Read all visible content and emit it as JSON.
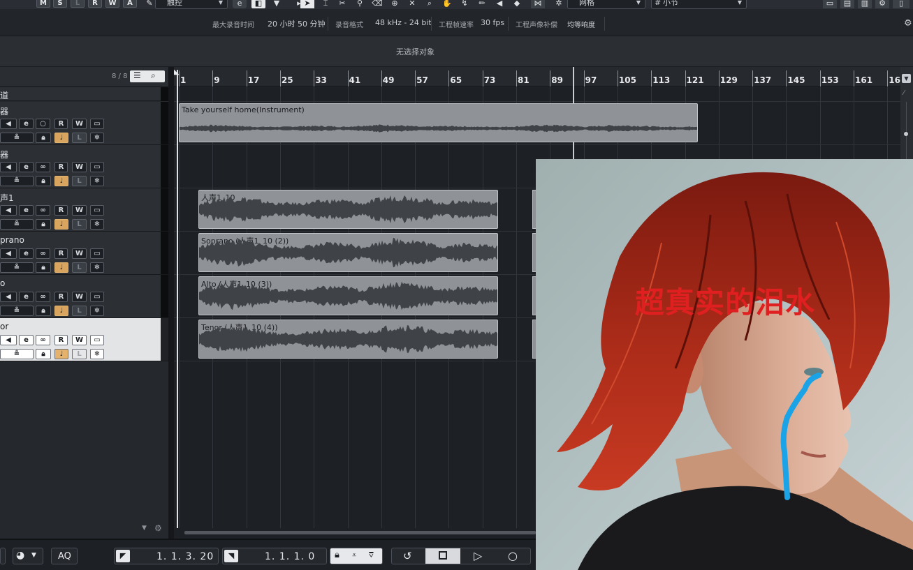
{
  "toolbar": {
    "state_buttons": [
      "M",
      "S",
      "L",
      "R",
      "W",
      "A"
    ],
    "automation_mode": "触控",
    "snap_type": "网格",
    "grid_value": "小节"
  },
  "infobar": {
    "max_rec_label": "最大录音时间",
    "max_rec_value": "20 小时 50 分钟",
    "rec_format_label": "录音格式",
    "rec_format_value": "48 kHz - 24 bit",
    "frame_rate_label": "工程帧速率",
    "frame_rate_value": "30 fps",
    "audio_offset_label": "工程声像补偿",
    "audio_offset_value": "均等响度"
  },
  "selection_bar": {
    "text": "无选择对象"
  },
  "track_list": {
    "count": "8 / 8",
    "tracks": [
      {
        "name": "道"
      },
      {
        "name": "器"
      },
      {
        "name": "器"
      },
      {
        "name": "声1"
      },
      {
        "name": "prano"
      },
      {
        "name": "o"
      },
      {
        "name": "or"
      }
    ],
    "row_buttons": {
      "e": "e",
      "r": "R",
      "w": "W"
    }
  },
  "ruler": {
    "bars": [
      "1",
      "9",
      "17",
      "25",
      "33",
      "41",
      "49",
      "57",
      "65",
      "73",
      "81",
      "89",
      "97",
      "105",
      "113",
      "121",
      "129",
      "137",
      "145",
      "153",
      "161",
      "16"
    ]
  },
  "events": [
    {
      "label": "Take yourself home(Instrument)"
    },
    {
      "label": "人声1_10"
    },
    {
      "label": "Soprano (人声1_10 (2))"
    },
    {
      "label": "Alto (人声1_10 (3))"
    },
    {
      "label": "Tenor (人声1_10 (4))"
    }
  ],
  "overlay": {
    "caption": "超真实的泪水"
  },
  "transport": {
    "aq_label": "AQ",
    "left_locator": "1.  1.  3. 20",
    "right_locator": "1.  1.  1.    0"
  },
  "colors": {
    "accent": "#d9a55e",
    "caption": "#e02020",
    "tear": "#1aa3e6"
  }
}
